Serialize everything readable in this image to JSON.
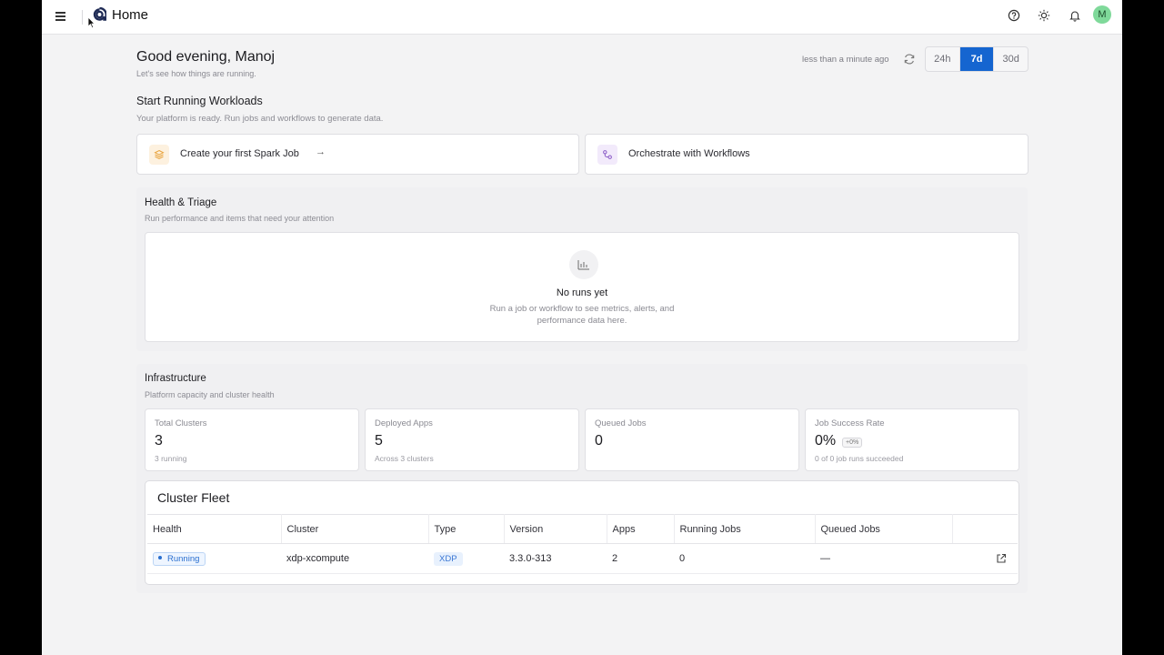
{
  "header": {
    "title": "Home",
    "avatar_initial": "M",
    "icons": [
      "menu-icon",
      "logo",
      "help-icon",
      "theme-sun-icon",
      "bell-icon"
    ]
  },
  "greeting": {
    "title": "Good evening, Manoj",
    "subtitle": "Let's see how things are running."
  },
  "refresh": {
    "last_updated": "less than a minute ago",
    "ranges": [
      "24h",
      "7d",
      "30d"
    ],
    "active_range": "7d"
  },
  "workloads": {
    "title": "Start Running Workloads",
    "subtitle": "Your platform is ready. Run jobs and workflows to generate data.",
    "actions": [
      {
        "label": "Create your first Spark Job",
        "arrow": "→",
        "icon": "layers-icon",
        "color": "#e8a33c"
      },
      {
        "label": "Orchestrate with Workflows",
        "icon": "workflow-icon",
        "color": "#8b5cc7"
      }
    ]
  },
  "health": {
    "title": "Health & Triage",
    "subtitle": "Run performance and items that need your attention",
    "empty_title": "No runs yet",
    "empty_desc": "Run a job or workflow to see metrics, alerts, and performance data here."
  },
  "infrastructure": {
    "title": "Infrastructure",
    "subtitle": "Platform capacity and cluster health",
    "stats": [
      {
        "label": "Total Clusters",
        "value": "3",
        "sub": "3 running"
      },
      {
        "label": "Deployed Apps",
        "value": "5",
        "sub": "Across 3 clusters"
      },
      {
        "label": "Queued Jobs",
        "value": "0",
        "sub": ""
      },
      {
        "label": "Job Success Rate",
        "value": "0%",
        "delta": "+0%",
        "sub": "0 of 0 job runs succeeded"
      }
    ]
  },
  "fleet": {
    "title": "Cluster Fleet",
    "columns": [
      "Health",
      "Cluster",
      "Type",
      "Version",
      "Apps",
      "Running Jobs",
      "Queued Jobs",
      ""
    ],
    "rows": [
      {
        "health": "Running",
        "cluster": "xdp-xcompute",
        "type": "XDP",
        "version": "3.3.0-313",
        "apps": "2",
        "running_jobs": "0",
        "queued_jobs": "—"
      }
    ]
  },
  "colors": {
    "accent": "#1565d0",
    "avatar": "#7fd99a",
    "status_running": "#2a6fcf"
  }
}
